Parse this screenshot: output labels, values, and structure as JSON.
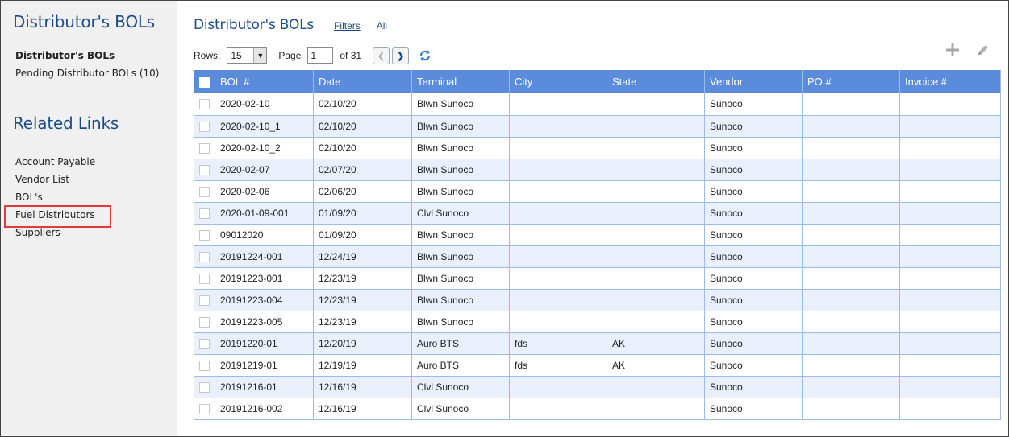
{
  "sidebar": {
    "title": "Distributor's BOLs",
    "nav": [
      {
        "label": "Distributor's BOLs",
        "active": true
      },
      {
        "label": "Pending Distributor BOLs (10)",
        "active": false
      }
    ],
    "related_title": "Related Links",
    "related": [
      {
        "label": "Account Payable"
      },
      {
        "label": "Vendor List"
      },
      {
        "label": "BOL's"
      },
      {
        "label": "Fuel Distributors",
        "highlighted": true
      },
      {
        "label": "Suppliers"
      }
    ]
  },
  "header": {
    "title": "Distributor's BOLs",
    "filters_label": "Filters",
    "all_label": "All"
  },
  "pager": {
    "rows_label": "Rows:",
    "rows_value": "15",
    "page_label": "Page",
    "page_value": "1",
    "of_label": "of 31",
    "prev_icon": "chevron-left-icon",
    "next_icon": "chevron-right-icon"
  },
  "table": {
    "columns": [
      "BOL #",
      "Date",
      "Terminal",
      "City",
      "State",
      "Vendor",
      "PO #",
      "Invoice #"
    ],
    "rows": [
      [
        "2020-02-10",
        "02/10/20",
        "Blwn Sunoco",
        "",
        "",
        "Sunoco",
        "",
        ""
      ],
      [
        "2020-02-10_1",
        "02/10/20",
        "Blwn Sunoco",
        "",
        "",
        "Sunoco",
        "",
        ""
      ],
      [
        "2020-02-10_2",
        "02/10/20",
        "Blwn Sunoco",
        "",
        "",
        "Sunoco",
        "",
        ""
      ],
      [
        "2020-02-07",
        "02/07/20",
        "Blwn Sunoco",
        "",
        "",
        "Sunoco",
        "",
        ""
      ],
      [
        "2020-02-06",
        "02/06/20",
        "Blwn Sunoco",
        "",
        "",
        "Sunoco",
        "",
        ""
      ],
      [
        "2020-01-09-001",
        "01/09/20",
        "Clvl Sunoco",
        "",
        "",
        "Sunoco",
        "",
        ""
      ],
      [
        "09012020",
        "01/09/20",
        "Blwn Sunoco",
        "",
        "",
        "Sunoco",
        "",
        ""
      ],
      [
        "20191224-001",
        "12/24/19",
        "Blwn Sunoco",
        "",
        "",
        "Sunoco",
        "",
        ""
      ],
      [
        "20191223-001",
        "12/23/19",
        "Blwn Sunoco",
        "",
        "",
        "Sunoco",
        "",
        ""
      ],
      [
        "20191223-004",
        "12/23/19",
        "Blwn Sunoco",
        "",
        "",
        "Sunoco",
        "",
        ""
      ],
      [
        "20191223-005",
        "12/23/19",
        "Blwn Sunoco",
        "",
        "",
        "Sunoco",
        "",
        ""
      ],
      [
        "20191220-01",
        "12/20/19",
        "Auro BTS",
        "fds",
        "AK",
        "Sunoco",
        "",
        ""
      ],
      [
        "20191219-01",
        "12/19/19",
        "Auro BTS",
        "fds",
        "AK",
        "Sunoco",
        "",
        ""
      ],
      [
        "20191216-01",
        "12/16/19",
        "Clvl Sunoco",
        "",
        "",
        "Sunoco",
        "",
        ""
      ],
      [
        "20191216-002",
        "12/16/19",
        "Clvl Sunoco",
        "",
        "",
        "Sunoco",
        "",
        ""
      ]
    ]
  },
  "colors": {
    "accent": "#1c4a8c",
    "header_bg": "#5b8cdc",
    "alt_row": "#e9f0fb",
    "highlight_box": "#e03a3a"
  },
  "icons": {
    "refresh": "refresh-icon",
    "add": "plus-icon",
    "edit": "pencil-icon"
  }
}
